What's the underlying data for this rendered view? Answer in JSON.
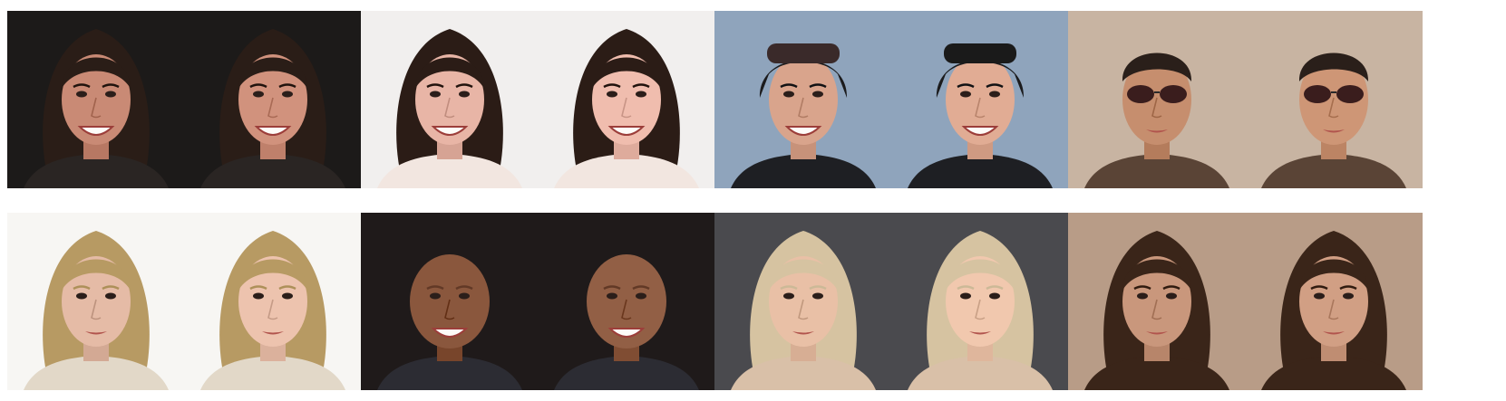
{
  "figure": {
    "rows": [
      {
        "pairs": [
          {
            "subject": "woman-dark-hair-dark-background",
            "colors": {
              "bg": "#1c1a19",
              "skin": "#c98a75",
              "hair": "#2a1d17",
              "shirt": "#2a2523"
            }
          },
          {
            "subject": "woman-dark-hair-light-background",
            "colors": {
              "bg": "#f1efee",
              "skin": "#e8b5a6",
              "hair": "#2b1c16",
              "shirt": "#f2e6e0"
            }
          },
          {
            "subject": "man-ski-helmet-goggles",
            "colors": {
              "bg": "#8fa4bc",
              "skin": "#d9a48c",
              "hair": "#1b1b1d",
              "shirt": "#1e1f23"
            }
          },
          {
            "subject": "man-aviator-sunglasses",
            "colors": {
              "bg": "#c8b4a2",
              "skin": "#c68e6e",
              "hair": "#2a1f1a",
              "shirt": "#5a4436"
            }
          }
        ]
      },
      {
        "pairs": [
          {
            "subject": "woman-blonde-white-background",
            "colors": {
              "bg": "#f7f6f3",
              "skin": "#e5bba6",
              "hair": "#b79a63",
              "shirt": "#e2d8c8"
            }
          },
          {
            "subject": "bald-smiling-man-dark-background",
            "colors": {
              "bg": "#1f1a1a",
              "skin": "#8a573d",
              "hair": "#6c4330",
              "shirt": "#2c2c33"
            }
          },
          {
            "subject": "woman-blonde-high-ponytail",
            "colors": {
              "bg": "#4a4a4e",
              "skin": "#e9c0a6",
              "hair": "#d6c3a1",
              "shirt": "#d9c0a8"
            }
          },
          {
            "subject": "woman-long-brown-hair",
            "colors": {
              "bg": "#b89c87",
              "skin": "#c9977c",
              "hair": "#3a2519",
              "shirt": "#3a2519"
            }
          }
        ]
      }
    ]
  }
}
